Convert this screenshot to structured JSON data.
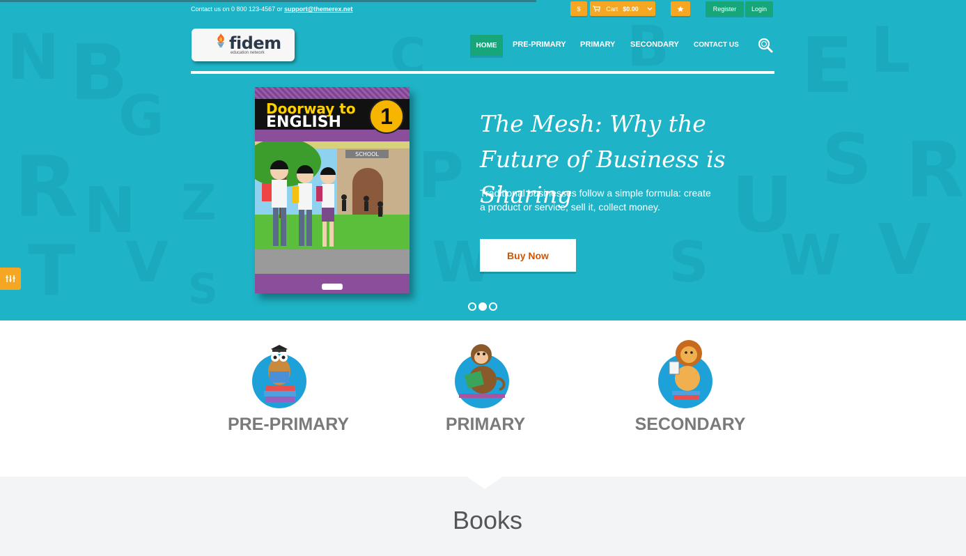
{
  "topbar": {
    "contact_prefix": "Contact us on 0 800 123-4567 or",
    "contact_email": "support@themerex.net",
    "currency_label": "$",
    "cart_label": "Cart",
    "cart_amount": "$0.00",
    "register_label": "Register",
    "login_label": "Login"
  },
  "logo": {
    "name": "fidem",
    "tagline": "education network"
  },
  "nav": {
    "items": [
      "HOME",
      "PRE-PRIMARY",
      "PRIMARY",
      "SECONDARY",
      "CONTACT US"
    ]
  },
  "slider": {
    "book_title_line1": "Doorway to",
    "book_title_line2": "ENGLISH",
    "book_number": "1",
    "book_school_sign": "SCHOOL",
    "title": "The Mesh: Why the Future of Business is Sharing",
    "text": "Traditional businesses follow a simple formula: create a product or service, sell it, collect money.",
    "button_label": "Buy Now",
    "active_slide": 2,
    "slide_count": 3
  },
  "categories": [
    {
      "label": "PRE-PRIMARY",
      "icon": "owl-reading-icon"
    },
    {
      "label": "PRIMARY",
      "icon": "monkey-reading-icon"
    },
    {
      "label": "SECONDARY",
      "icon": "lion-reading-icon"
    }
  ],
  "books_section": {
    "title": "Books"
  },
  "colors": {
    "hero_bg": "#1eb3c6",
    "accent_green": "#16a67a",
    "accent_orange": "#f5a623",
    "category_circle": "#1ea0d8",
    "buy_text": "#d35400"
  }
}
